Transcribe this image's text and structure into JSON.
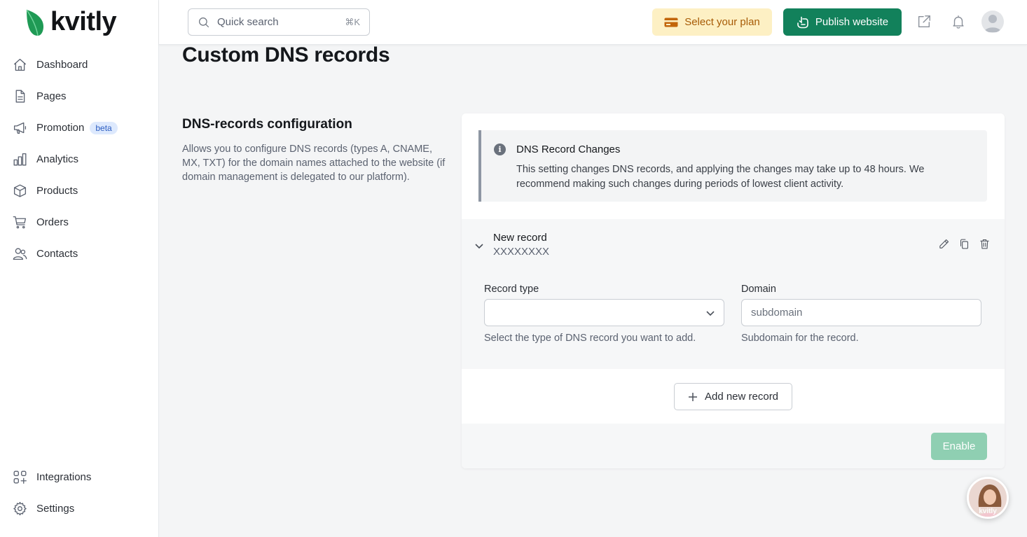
{
  "brand": {
    "name": "kvitly",
    "logo_color": "#22a05a"
  },
  "sidebar": {
    "items": [
      {
        "label": "Dashboard",
        "icon": "home-icon"
      },
      {
        "label": "Pages",
        "icon": "document-icon"
      },
      {
        "label": "Promotion",
        "icon": "megaphone-icon",
        "badge": "beta"
      },
      {
        "label": "Analytics",
        "icon": "bar-chart-icon"
      },
      {
        "label": "Products",
        "icon": "box-icon"
      },
      {
        "label": "Orders",
        "icon": "cart-icon"
      },
      {
        "label": "Contacts",
        "icon": "users-icon"
      }
    ],
    "bottom_items": [
      {
        "label": "Integrations",
        "icon": "grid-plus-icon"
      },
      {
        "label": "Settings",
        "icon": "gear-icon"
      }
    ]
  },
  "topbar": {
    "search_placeholder": "Quick search",
    "search_shortcut": "⌘K",
    "plan_label": "Select your plan",
    "publish_label": "Publish website"
  },
  "main": {
    "page_title": "Custom DNS records",
    "section_title": "DNS-records configuration",
    "section_description": "Allows you to configure DNS records (types A, CNAME, MX, TXT) for the domain names attached to the website (if domain management is delegated to our platform).",
    "notice": {
      "title": "DNS Record Changes",
      "text": "This setting changes DNS records, and applying the changes may take up to 48 hours. We recommend making such changes during periods of lowest client activity."
    },
    "record": {
      "name": "New record",
      "value": "XXXXXXXX",
      "record_type_label": "Record type",
      "record_type_value": "",
      "record_type_hint": "Select the type of DNS record you want to add.",
      "domain_label": "Domain",
      "domain_placeholder": "subdomain",
      "domain_hint": "Subdomain for the record."
    },
    "add_record_label": "Add new record",
    "enable_label": "Enable"
  },
  "chat": {
    "label": "kvitly"
  },
  "colors": {
    "primary": "#12815b",
    "plan_bg": "#fdf0c4",
    "plan_text": "#a75b06",
    "badge_bg": "#dde9fd",
    "enable_disabled": "#8fcfb2"
  }
}
